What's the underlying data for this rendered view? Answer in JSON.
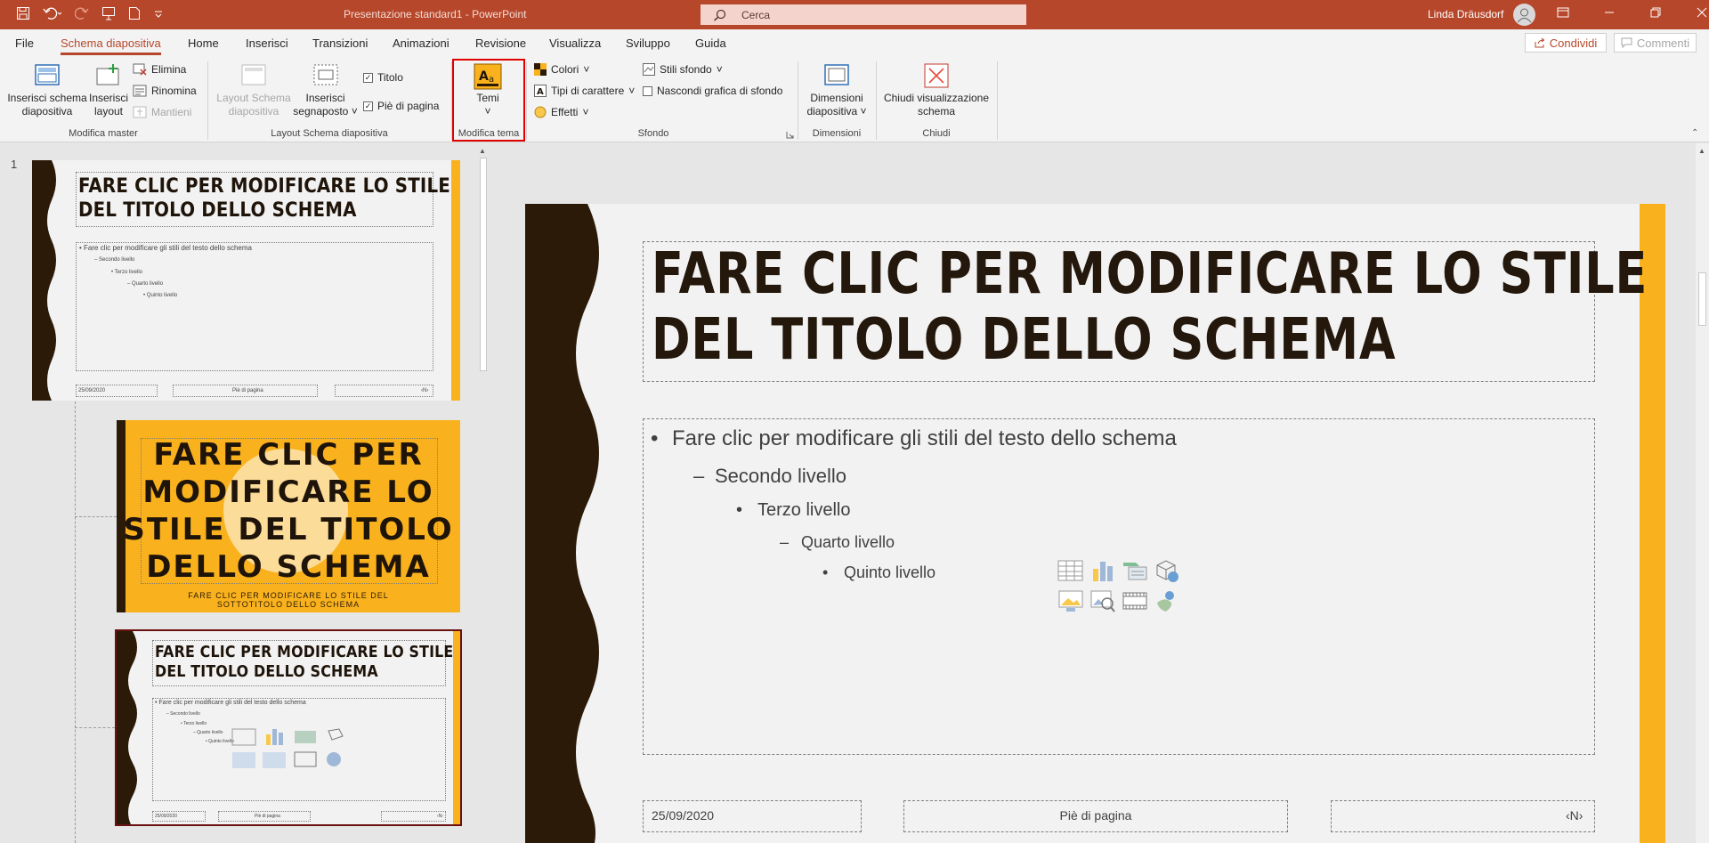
{
  "titlebar": {
    "title": "Presentazione standard1  -  PowerPoint",
    "search_placeholder": "Cerca",
    "user_name": "Linda Dräusdorf"
  },
  "tabs": {
    "items": [
      "File",
      "Schema diapositiva",
      "Home",
      "Inserisci",
      "Transizioni",
      "Animazioni",
      "Revisione",
      "Visualizza",
      "Sviluppo",
      "Guida"
    ],
    "active": "Schema diapositiva",
    "share_label": "Condividi",
    "comments_label": "Commenti"
  },
  "ribbon": {
    "modifica_master": {
      "label": "Modifica master",
      "insert_master_l1": "Inserisci schema",
      "insert_master_l2": "diapositiva",
      "insert_layout_l1": "Inserisci",
      "insert_layout_l2": "layout",
      "delete": "Elimina",
      "rename": "Rinomina",
      "preserve": "Mantieni"
    },
    "layout": {
      "label": "Layout Schema diapositiva",
      "master_layout_l1": "Layout Schema",
      "master_layout_l2": "diapositiva",
      "insert_placeholder_l1": "Inserisci",
      "insert_placeholder_l2": "segnaposto",
      "title_check": "Titolo",
      "footer_check": "Piè di pagina"
    },
    "tema": {
      "label": "Modifica tema",
      "themes": "Temi"
    },
    "sfondo": {
      "label": "Sfondo",
      "colors": "Colori",
      "fonts": "Tipi di carattere",
      "effects": "Effetti",
      "bg_styles": "Stili sfondo",
      "hide_bg": "Nascondi grafica di sfondo"
    },
    "dimensioni": {
      "label": "Dimensioni",
      "size_l1": "Dimensioni",
      "size_l2": "diapositiva"
    },
    "chiudi": {
      "label": "Chiudi",
      "close_l1": "Chiudi visualizzazione",
      "close_l2": "schema"
    }
  },
  "thumbnails": {
    "number": "1",
    "master": {
      "title_l1": "FARE CLIC PER MODIFICARE LO STILE",
      "title_l2": "DEL TITOLO DELLO SCHEMA",
      "text_l1": "Fare clic per modificare gli stili del testo dello schema",
      "text_l2": "Secondo livello",
      "text_l3": "Terzo livello",
      "text_l4": "Quarto livello",
      "text_l5": "Quinto livello",
      "date": "25/09/2020",
      "footer": "Piè di pagina",
      "page": "‹N›"
    },
    "title_slide": {
      "title_l1": "FARE CLIC PER",
      "title_l2": "MODIFICARE LO",
      "title_l3": "STILE DEL TITOLO",
      "title_l4": "DELLO SCHEMA",
      "subtitle_l1": "FARE CLIC PER MODIFICARE LO STILE DEL",
      "subtitle_l2": "SOTTOTITOLO DELLO SCHEMA"
    },
    "content_slide": {
      "title_l1": "FARE CLIC PER MODIFICARE LO STILE",
      "title_l2": "DEL TITOLO DELLO SCHEMA",
      "text_l1": "Fare clic per modificare gli stili del testo dello schema",
      "text_l2": "Secondo livello",
      "text_l3": "Terzo livello",
      "text_l4": "Quarto livello",
      "text_l5": "Quinto livello",
      "date": "25/09/2020",
      "footer": "Piè di pagina",
      "page": "‹N›"
    }
  },
  "slide": {
    "title_l1": "FARE CLIC PER MODIFICARE LO STILE",
    "title_l2": "DEL TITOLO DELLO SCHEMA",
    "level1": "Fare clic per modificare gli stili del testo dello schema",
    "level2": "Secondo livello",
    "level3": "Terzo livello",
    "level4": "Quarto livello",
    "level5": "Quinto livello",
    "date": "25/09/2020",
    "footer": "Piè di pagina",
    "page": "‹N›"
  },
  "colors": {
    "accent": "#b7472a",
    "brown": "#2b1a08",
    "gold": "#f9b21d"
  }
}
